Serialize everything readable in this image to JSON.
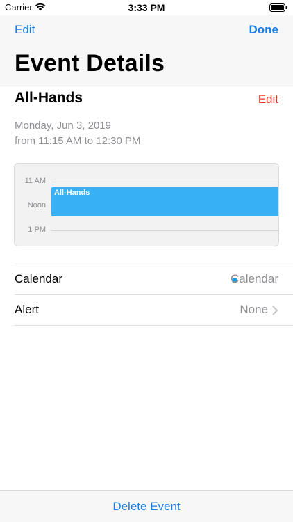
{
  "status_bar": {
    "carrier": "Carrier",
    "time": "3:33 PM"
  },
  "nav": {
    "left_label": "Edit",
    "right_label": "Done",
    "title": "Event Details"
  },
  "event": {
    "title": "All-Hands",
    "edit_label": "Edit",
    "date": "Monday, Jun 3, 2019",
    "time_range": "from 11:15 AM to 12:30 PM"
  },
  "day_preview": {
    "hours": [
      "11 AM",
      "Noon",
      "1 PM"
    ],
    "event_label": "All-Hands",
    "event_color": "#37b0f5"
  },
  "details": [
    {
      "label": "Calendar",
      "value": "Calendar",
      "dot_color": "#1a9ee0"
    },
    {
      "label": "Alert",
      "value": "None"
    }
  ],
  "toolbar": {
    "delete_label": "Delete Event"
  },
  "colors": {
    "accent": "#1a7de0",
    "destructive": "#e8352b"
  }
}
